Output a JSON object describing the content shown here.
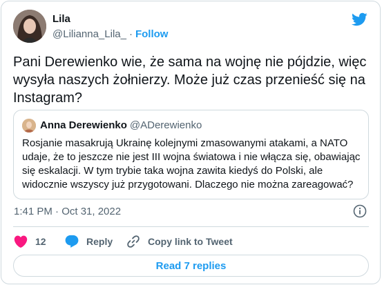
{
  "author": {
    "name": "Lila",
    "handle": "@Lilianna_Lila_",
    "separator": "·",
    "follow_label": "Follow"
  },
  "tweet": {
    "text": "Pani Derewienko wie, że sama na wojnę nie pójdzie, więc wysyła naszych żołnierzy. Może już czas przenieść się na Instagram?",
    "timestamp": "1:41 PM · Oct 31, 2022"
  },
  "quoted_tweet": {
    "name": "Anna Derewienko",
    "handle": "@ADerewienko",
    "text": "Rosjanie masakrują Ukrainę kolejnymi zmasowanymi atakami, a NATO udaje, że to jeszcze nie jest III wojna światowa i nie włącza się, obawiając się eskalacji. W tym trybie taka wojna zawita kiedyś do Polski, ale widocznie wszyscy już przygotowani. Dlaczego nie można zareagować?"
  },
  "actions": {
    "like_count": "12",
    "reply_label": "Reply",
    "copy_link_label": "Copy link to Tweet"
  },
  "footer": {
    "read_replies_label": "Read 7 replies"
  },
  "colors": {
    "brand_blue": "#1d9bf0",
    "like_red": "#f91880",
    "text_primary": "#0f1419",
    "text_secondary": "#536471",
    "border": "#cfd9de"
  },
  "icons": [
    "twitter-bird-icon",
    "heart-icon",
    "reply-bubble-icon",
    "link-icon",
    "info-icon"
  ]
}
